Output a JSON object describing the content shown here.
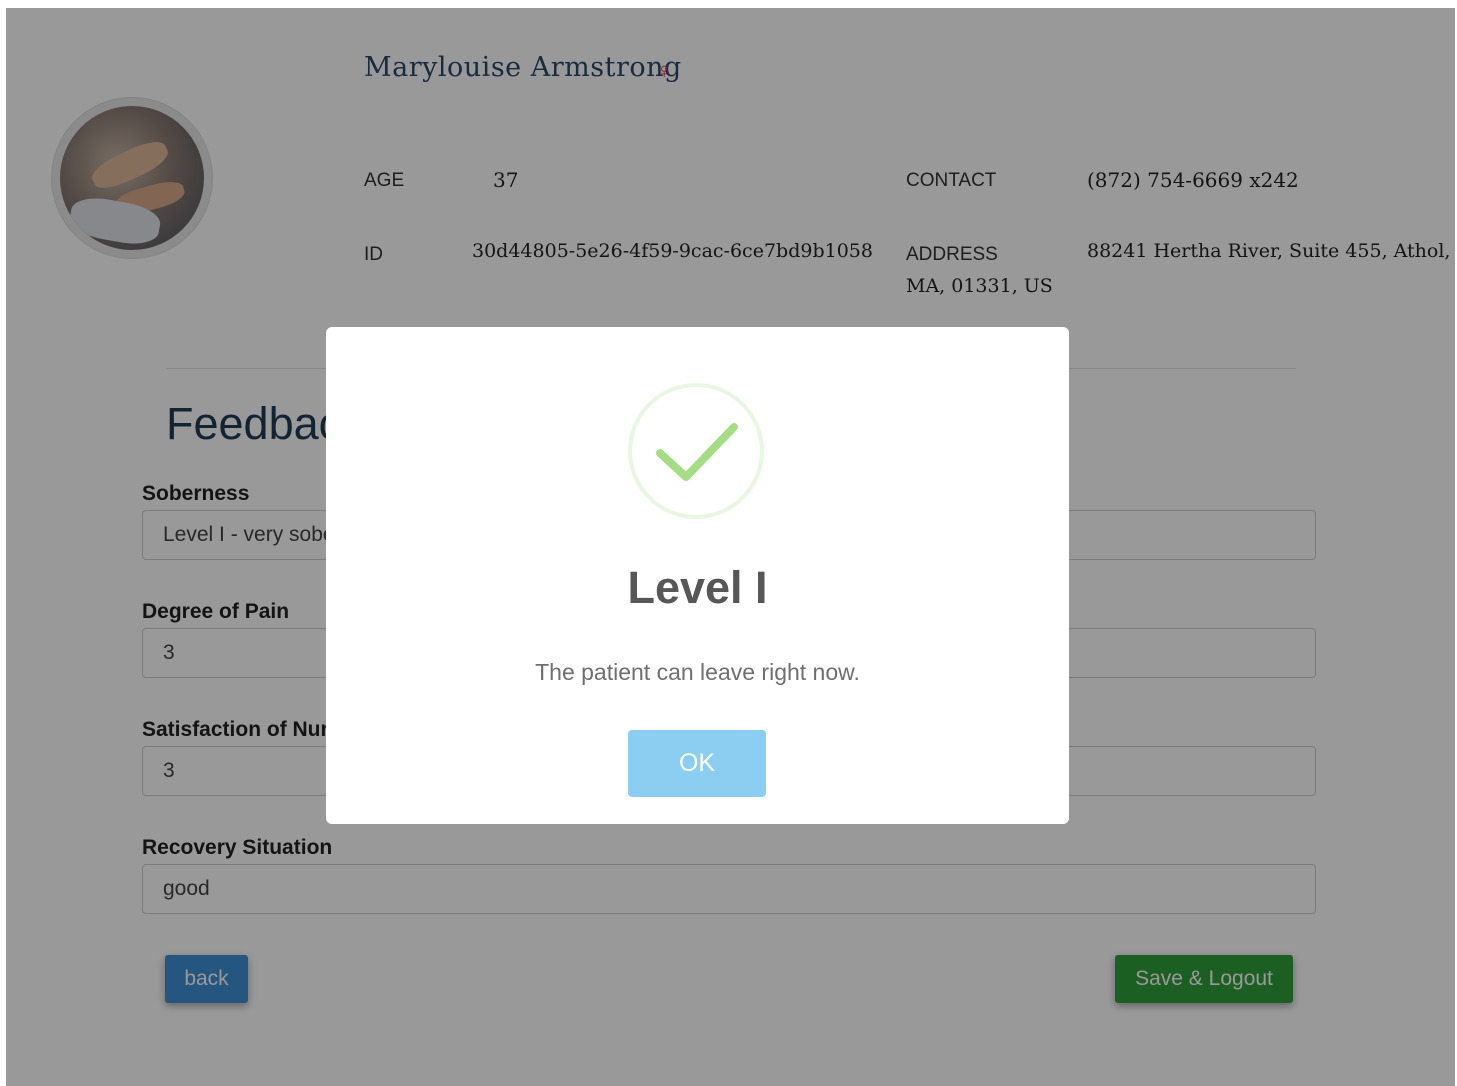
{
  "patient": {
    "name": "Marylouise  Armstrong",
    "gender_symbol": "♀",
    "age_label": "AGE",
    "age": "37",
    "id_label": "ID",
    "id": "30d44805-5e26-4f59-9cac-6ce7bd9b1058",
    "contact_label": "CONTACT",
    "contact": "(872) 754-6669 x242",
    "address_label": "ADDRESS",
    "address_line1": "88241 Hertha River, Suite 455, Athol,",
    "address_line2": "MA, 01331, US"
  },
  "form": {
    "title": "Feedback",
    "fields": [
      {
        "label": "Soberness",
        "value": "Level I - very sober"
      },
      {
        "label": "Degree of Pain",
        "value": "3"
      },
      {
        "label": "Satisfaction of Nurse",
        "value": "3"
      },
      {
        "label": "Recovery Situation",
        "value": "good"
      }
    ],
    "back_label": "back",
    "save_label": "Save & Logout"
  },
  "modal": {
    "icon": "success-check-icon",
    "title": "Level I",
    "text": "The patient can leave right now.",
    "ok_label": "OK"
  },
  "colors": {
    "overlay": "rgba(0,0,0,0.4)",
    "success_check": "#a5dc86",
    "ok_button": "#8ccdf2",
    "back_button": "#3d8fd6",
    "save_button": "#2f9e3b",
    "gender_icon": "#d62b4d"
  }
}
